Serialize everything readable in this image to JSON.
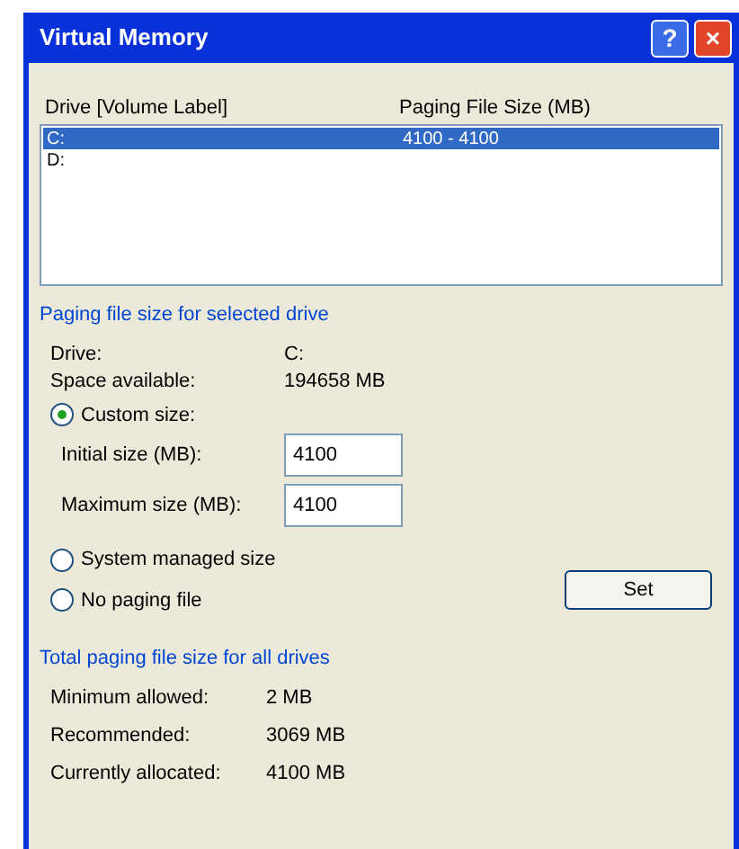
{
  "window": {
    "title": "Virtual Memory",
    "buttons": [
      {
        "kind": "help",
        "label": "?"
      },
      {
        "kind": "close",
        "label": "×"
      }
    ]
  },
  "drive_list": {
    "columns": [
      "Drive  [Volume Label]",
      "Paging File Size (MB)"
    ],
    "rows": [
      {
        "drive": "C:",
        "size": "4100 - 4100",
        "selected": true
      },
      {
        "drive": "D:",
        "size": "",
        "selected": false
      }
    ]
  },
  "selected_drive": {
    "title": "Paging file size for selected drive",
    "info": [
      {
        "label": "Drive:",
        "value": "C:"
      },
      {
        "label": "Space available:",
        "value": "194658 MB"
      }
    ],
    "options": [
      {
        "label": "Custom size:",
        "selected": true
      },
      {
        "label": "System managed size",
        "selected": false
      },
      {
        "label": "No paging file",
        "selected": false
      }
    ],
    "fields": [
      {
        "label": "Initial size (MB):",
        "value": "4100"
      },
      {
        "label": "Maximum size (MB):",
        "value": "4100"
      }
    ],
    "set_button": "Set"
  },
  "totals": {
    "title": "Total paging file size for all drives",
    "rows": [
      {
        "label": "Minimum allowed:",
        "value": "2 MB"
      },
      {
        "label": "Recommended:",
        "value": "3069 MB"
      },
      {
        "label": "Currently allocated:",
        "value": "4100 MB"
      }
    ]
  }
}
